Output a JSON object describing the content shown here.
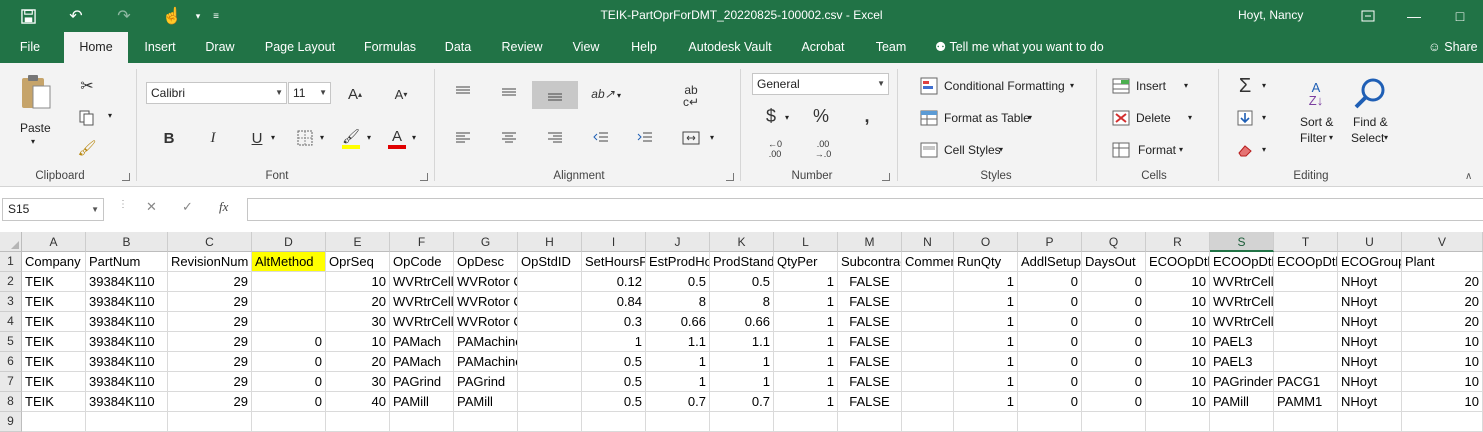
{
  "window": {
    "title": "TEIK-PartOprForDMT_20220825-100002.csv  -  Excel",
    "user": "Hoyt, Nancy"
  },
  "tabs": [
    "File",
    "Home",
    "Insert",
    "Draw",
    "Page Layout",
    "Formulas",
    "Data",
    "Review",
    "View",
    "Help",
    "Autodesk Vault",
    "Acrobat",
    "Team"
  ],
  "active_tab": "Home",
  "tell_me": "Tell me what you want to do",
  "share_label": "Share",
  "ribbon": {
    "clipboard": {
      "label": "Clipboard",
      "paste": "Paste"
    },
    "font": {
      "label": "Font",
      "name": "Calibri",
      "size": "11",
      "bold": "B",
      "italic": "I",
      "underline": "U"
    },
    "alignment": {
      "label": "Alignment"
    },
    "number": {
      "label": "Number",
      "format": "General",
      "currency": "$",
      "percent": "%",
      "comma": ","
    },
    "styles": {
      "label": "Styles",
      "conditional": "Conditional Formatting",
      "table": "Format as Table",
      "cell_styles": "Cell Styles"
    },
    "cells": {
      "label": "Cells",
      "insert": "Insert",
      "delete": "Delete",
      "format": "Format"
    },
    "editing": {
      "label": "Editing",
      "sort_line1": "Sort &",
      "sort_line2": "Filter",
      "find_line1": "Find &",
      "find_line2": "Select"
    }
  },
  "formula_bar": {
    "name_box": "S15",
    "fx": "fx",
    "value": ""
  },
  "grid": {
    "columns": [
      "A",
      "B",
      "C",
      "D",
      "E",
      "F",
      "G",
      "H",
      "I",
      "J",
      "K",
      "L",
      "M",
      "N",
      "O",
      "P",
      "Q",
      "R",
      "S",
      "T",
      "U",
      "V"
    ],
    "selected_column": "S",
    "row_numbers": [
      "1",
      "2",
      "3",
      "4",
      "5",
      "6",
      "7",
      "8",
      "9"
    ],
    "rows": [
      [
        "Company",
        "PartNum",
        "RevisionNum",
        "AltMethod",
        "OprSeq",
        "OpCode",
        "OpDesc",
        "OpStdID",
        "SetHoursPerMach",
        "EstProdHours",
        "ProdStandard",
        "QtyPer",
        "SubcontractFlag",
        "CommentText",
        "RunQty",
        "AddlSetupHours",
        "DaysOut",
        "ECOOpDtlSeq",
        "ECOOpDtlResourceGrpID",
        "ECOOpDtlResourceID",
        "ECOGroupID",
        "Plant"
      ],
      [
        "TEIK",
        "39384K110",
        "29",
        "",
        "10",
        "WVRtrCell",
        "WVRotor Cell",
        "",
        "0.12",
        "0.5",
        "0.5",
        "1",
        "FALSE",
        "",
        "1",
        "0",
        "0",
        "10",
        "WVRtrCell",
        "",
        "NHoyt",
        "20"
      ],
      [
        "TEIK",
        "39384K110",
        "29",
        "",
        "20",
        "WVRtrCell",
        "WVRotor Cell",
        "",
        "0.84",
        "8",
        "8",
        "1",
        "FALSE",
        "",
        "1",
        "0",
        "0",
        "10",
        "WVRtrCell",
        "",
        "NHoyt",
        "20"
      ],
      [
        "TEIK",
        "39384K110",
        "29",
        "",
        "30",
        "WVRtrCell",
        "WVRotor Cell",
        "",
        "0.3",
        "0.66",
        "0.66",
        "1",
        "FALSE",
        "",
        "1",
        "0",
        "0",
        "10",
        "WVRtrCell",
        "",
        "NHoyt",
        "20"
      ],
      [
        "TEIK",
        "39384K110",
        "29",
        "0",
        "10",
        "PAMach",
        "PAMachine",
        "",
        "1",
        "1.1",
        "1.1",
        "1",
        "FALSE",
        "",
        "1",
        "0",
        "0",
        "10",
        "PAEL3",
        "",
        "NHoyt",
        "10"
      ],
      [
        "TEIK",
        "39384K110",
        "29",
        "0",
        "20",
        "PAMach",
        "PAMachine",
        "",
        "0.5",
        "1",
        "1",
        "1",
        "FALSE",
        "",
        "1",
        "0",
        "0",
        "10",
        "PAEL3",
        "",
        "NHoyt",
        "10"
      ],
      [
        "TEIK",
        "39384K110",
        "29",
        "0",
        "30",
        "PAGrind",
        "PAGrind",
        "",
        "0.5",
        "1",
        "1",
        "1",
        "FALSE",
        "",
        "1",
        "0",
        "0",
        "10",
        "PAGrinder",
        "PACG1",
        "NHoyt",
        "10"
      ],
      [
        "TEIK",
        "39384K110",
        "29",
        "0",
        "40",
        "PAMill",
        "PAMill",
        "",
        "0.5",
        "0.7",
        "0.7",
        "1",
        "FALSE",
        "",
        "1",
        "0",
        "0",
        "10",
        "PAMill",
        "PAMM1",
        "NHoyt",
        "10"
      ],
      [
        "",
        "",
        "",
        "",
        "",
        "",
        "",
        "",
        "",
        "",
        "",
        "",
        "",
        "",
        "",
        "",
        "",
        "",
        "",
        "",
        "",
        ""
      ]
    ]
  }
}
